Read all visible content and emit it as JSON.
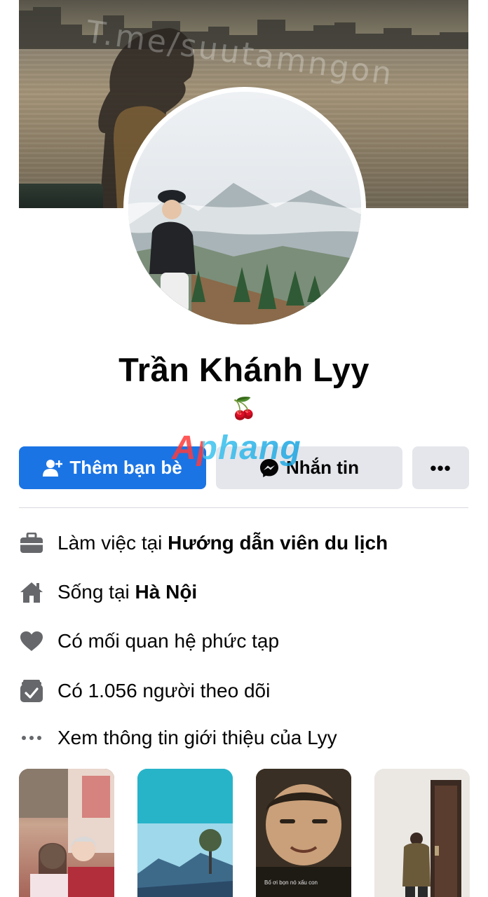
{
  "cover": {
    "watermark_text": "T.me/suutamngon"
  },
  "profile": {
    "name": "Trần Khánh Lyy",
    "bio_emoji": "🍒"
  },
  "actions": {
    "add_friend_label": "Thêm bạn bè",
    "message_label": "Nhắn tin",
    "more_label": "•••",
    "primary_color": "#1b74e4"
  },
  "overlay_brand": "Aphang",
  "intro": {
    "work_prefix": "Làm việc tại ",
    "work_place": "Hướng dẫn viên du lịch",
    "lives_prefix": "Sống tại ",
    "lives_place": "Hà Nội",
    "relationship": "Có mối quan hệ phức tạp",
    "followers": "Có 1.056 người theo dõi",
    "see_about": "Xem thông tin giới thiệu của Lyy"
  },
  "stories": [
    {
      "name": "story-1"
    },
    {
      "name": "story-2"
    },
    {
      "name": "story-3",
      "caption": "Bố ơi bọn nó xấu con"
    },
    {
      "name": "story-4"
    }
  ]
}
